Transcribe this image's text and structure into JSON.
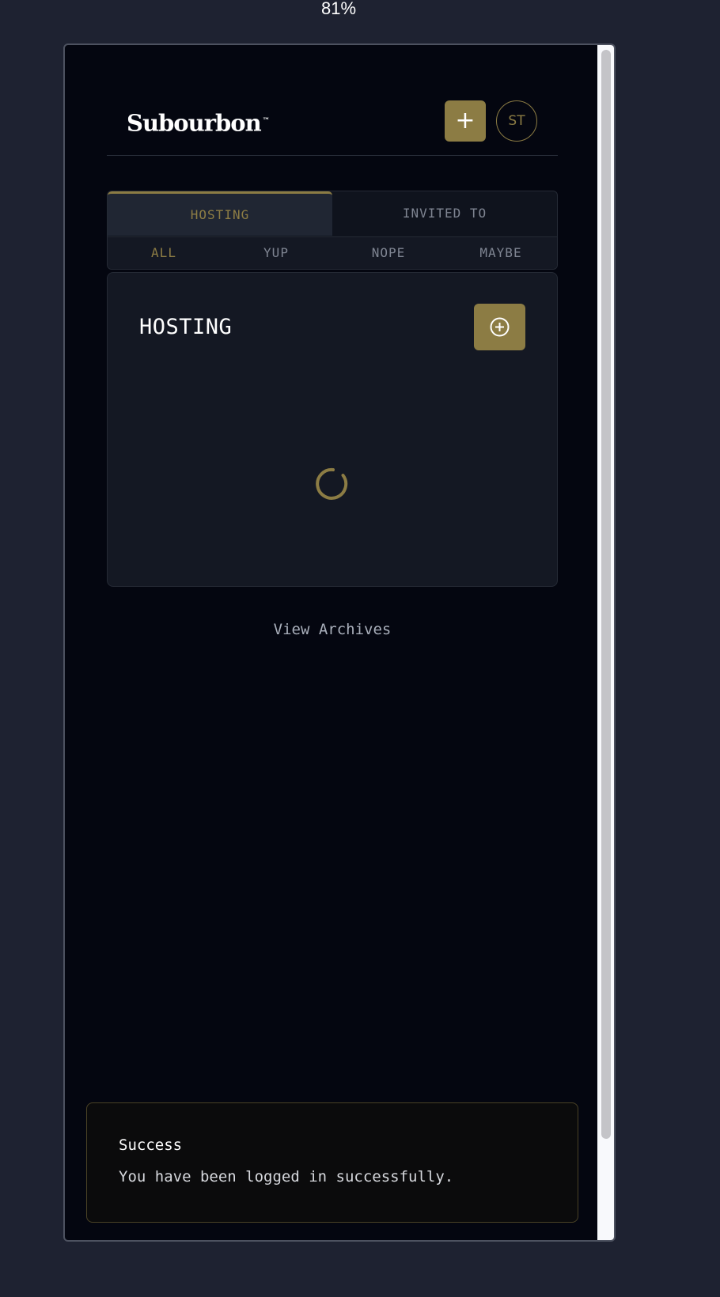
{
  "browser": {
    "zoom_label": "81%"
  },
  "app": {
    "logo_text": "Subourbon",
    "logo_mark": "™"
  },
  "header": {
    "add_button_label": "+",
    "avatar_initials": "ST",
    "accent_color": "#8c7c44"
  },
  "tabs": {
    "main": [
      {
        "label": "HOSTING",
        "active": true
      },
      {
        "label": "INVITED TO",
        "active": false
      }
    ],
    "sub": [
      {
        "label": "ALL",
        "active": true
      },
      {
        "label": "YUP",
        "active": false
      },
      {
        "label": "NOPE",
        "active": false
      },
      {
        "label": "MAYBE",
        "active": false
      }
    ]
  },
  "card": {
    "title": "HOSTING",
    "add_icon": "plus-circle-icon",
    "loading_icon": "spinner-icon"
  },
  "links": {
    "view_archives": "View Archives"
  },
  "toast": {
    "title": "Success",
    "message": "You have been logged in successfully."
  },
  "colors": {
    "background": "#040610",
    "surface": "#141823",
    "accent": "#8c7c44",
    "muted_text": "#7f8592"
  }
}
